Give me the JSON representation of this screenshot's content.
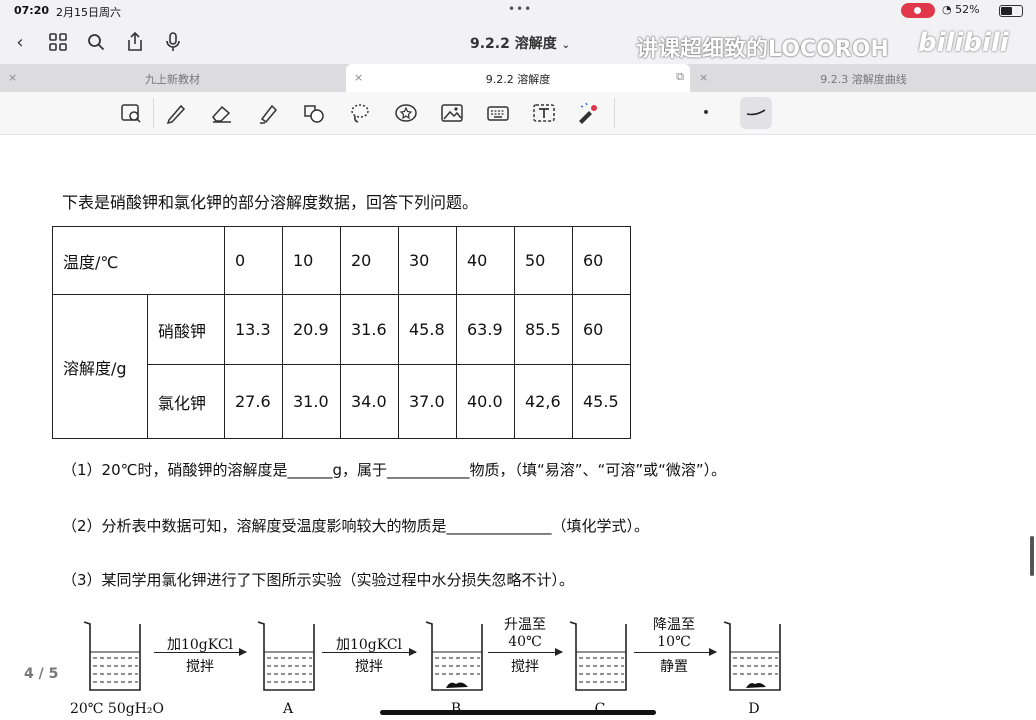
{
  "status": {
    "time": "07:20",
    "date": "2月15日周六",
    "dots": "•••",
    "battery": "52%"
  },
  "nav": {
    "title": "9.2.2 溶解度",
    "watermark": "讲课超细致的LOCOROH",
    "brand": "bilibili"
  },
  "tabs": [
    {
      "label": "九上新教材",
      "active": false
    },
    {
      "label": "9.2.2 溶解度",
      "active": true
    },
    {
      "label": "9.2.3 溶解度曲线",
      "active": false
    }
  ],
  "question": {
    "intro": "下表是硝酸钾和氯化钾的部分溶解度数据，回答下列问题。",
    "q1": "（1）20℃时，硝酸钾的溶解度是______g，属于___________物质，（填“易溶”、“可溶”或“微溶”）。",
    "q2": "（2）分析表中数据可知，溶解度受温度影响较大的物质是______________（填化学式）。",
    "q3": "（3）某同学用氯化钾进行了下图所示实验（实验过程中水分损失忽略不计）。"
  },
  "table": {
    "temp_label": "温度/℃",
    "temps": [
      "0",
      "10",
      "20",
      "30",
      "40",
      "50",
      "60"
    ],
    "sol_label": "溶解度/g",
    "rows": [
      {
        "name": "硝酸钾",
        "values": [
          "13.3",
          "20.9",
          "31.6",
          "45.8",
          "63.9",
          "85.5",
          "60"
        ]
      },
      {
        "name": "氯化钾",
        "values": [
          "27.6",
          "31.0",
          "34.0",
          "37.0",
          "40.0",
          "42,6",
          "45.5"
        ]
      }
    ]
  },
  "diagram": {
    "start": "20℃ 50gH₂O",
    "beakers": [
      "A",
      "B",
      "C",
      "D"
    ],
    "steps": [
      {
        "line1": "加10gKCl",
        "line2": "搅拌"
      },
      {
        "line1": "加10gKCl",
        "line2": "搅拌"
      },
      {
        "line0": "升温至",
        "line1": "40℃",
        "line2": "搅拌"
      },
      {
        "line0": "降温至",
        "line1": "10℃",
        "line2": "静置"
      }
    ]
  },
  "page_indicator": "4 / 5"
}
